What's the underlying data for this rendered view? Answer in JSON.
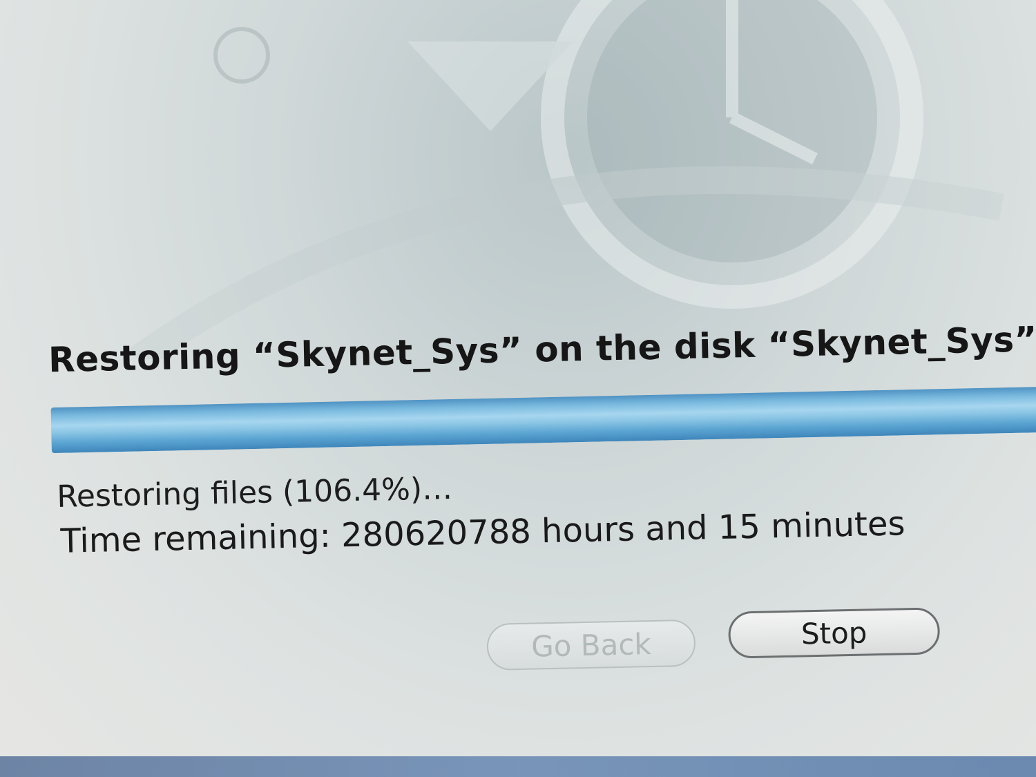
{
  "dialog": {
    "title": "Restoring “Skynet_Sys” on the disk “Skynet_Sys”",
    "status_prefix": "Restoring files ",
    "status_percent": "106.4",
    "time_remaining": "Time remaining: 280620788 hours and 15 minutes",
    "progress_fraction": 1.0
  },
  "buttons": {
    "go_back": "Go Back",
    "stop": "Stop"
  },
  "colors": {
    "progress_blue": "#79b9de",
    "text": "#161616",
    "disabled_text": "#b2b9b9"
  },
  "icons": {
    "background_art": "time-machine-restore-icon"
  }
}
